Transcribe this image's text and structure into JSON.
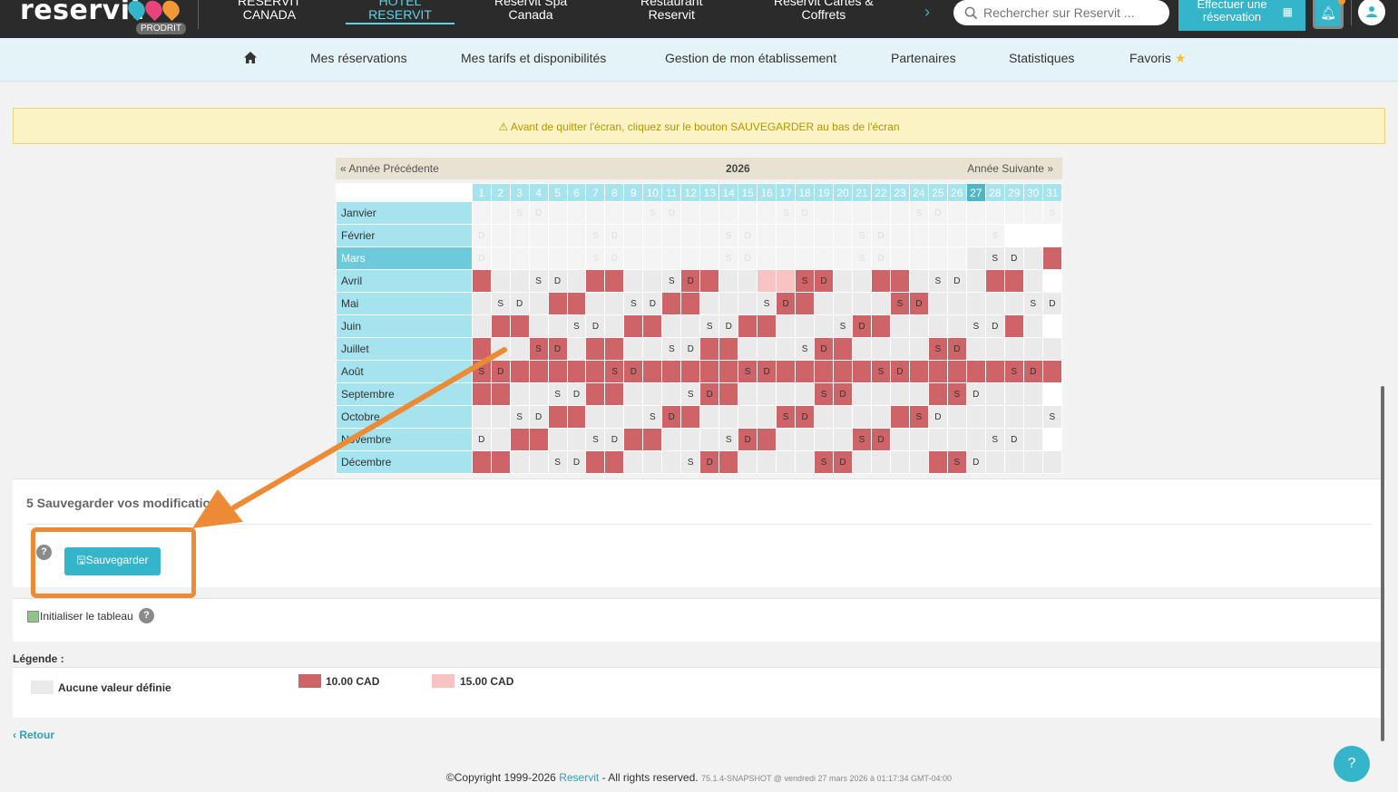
{
  "header": {
    "logo_text": "reservit",
    "logo_badge": "PRODRIT",
    "nav": [
      {
        "line1": "RESERVIT",
        "line2": "CANADA"
      },
      {
        "line1": "HOTEL",
        "line2": "RESERVIT"
      },
      {
        "line1": "Reservit Spa",
        "line2": "Canada"
      },
      {
        "line1": "Restaurant",
        "line2": "Reservit"
      },
      {
        "line1": "Reservit Cartes &",
        "line2": "Coffrets"
      }
    ],
    "search_placeholder": "Rechercher sur Reservit ...",
    "cta_line1": "Effectuer une",
    "cta_line2": "réservation"
  },
  "subnav": {
    "items": [
      "Mes réservations",
      "Mes tarifs et disponibilités",
      "Gestion de mon établissement",
      "Partenaires",
      "Statistiques",
      "Favoris"
    ]
  },
  "warning": "Avant de quitter l'écran, cliquez sur le bouton SAUVEGARDER au bas de l'écran",
  "calendar": {
    "prev": "« Année Précédente",
    "year": "2026",
    "next": "Année Suivante »",
    "today_day": 27,
    "active_month": "Mars",
    "months": [
      {
        "name": "Janvier",
        "cells": "0000000000000000000000000000000",
        "past": 31
      },
      {
        "name": "Février",
        "cells": "0000000000000000000000000000",
        "past": 28
      },
      {
        "name": "Mars",
        "cells": "0000000000000000000000000000001",
        "past": 26
      },
      {
        "name": "Avril",
        "cells": "100000110001100221100110000110",
        "past": 0
      },
      {
        "name": "Mai",
        "cells": "0000110000110000110000110000000",
        "past": 0
      },
      {
        "name": "Juin",
        "cells": "011000001100001100001100000010",
        "past": 0
      },
      {
        "name": "Juillet",
        "cells": "1001101100001100001100001100000",
        "past": 0
      },
      {
        "name": "Août",
        "cells": "1111111111111111111111111111111",
        "past": 0
      },
      {
        "name": "Septembre",
        "cells": "110000110000110000110000110000",
        "past": 0
      },
      {
        "name": "Octobre",
        "cells": "0000110000110000110000110000000",
        "past": 0
      },
      {
        "name": "Novembre",
        "cells": "001100001100001100001100000000",
        "past": 0
      },
      {
        "name": "Décembre",
        "cells": "1100001100001100001100001100000",
        "past": 0
      }
    ],
    "weekends": {
      "Janvier": [
        3,
        4,
        10,
        11,
        17,
        18,
        24,
        25,
        31
      ],
      "Février": [
        1,
        7,
        8,
        14,
        15,
        21,
        22,
        28
      ],
      "Mars": [
        1,
        7,
        8,
        14,
        15,
        21,
        22,
        28,
        29
      ],
      "Avril": [
        4,
        5,
        11,
        12,
        18,
        19,
        25,
        26
      ],
      "Mai": [
        2,
        3,
        9,
        10,
        16,
        17,
        23,
        24,
        30,
        31
      ],
      "Juin": [
        6,
        7,
        13,
        14,
        20,
        21,
        27,
        28
      ],
      "Juillet": [
        4,
        5,
        11,
        12,
        18,
        19,
        25,
        26
      ],
      "Août": [
        1,
        2,
        8,
        9,
        15,
        16,
        22,
        23,
        29,
        30
      ],
      "Septembre": [
        5,
        6,
        12,
        13,
        19,
        20,
        26,
        27
      ],
      "Octobre": [
        3,
        4,
        10,
        11,
        17,
        18,
        24,
        25,
        31
      ],
      "Novembre": [
        1,
        7,
        8,
        14,
        15,
        21,
        22,
        28,
        29
      ],
      "Décembre": [
        5,
        6,
        12,
        13,
        19,
        20,
        26,
        27
      ]
    },
    "sat_label": "S",
    "sun_label": "D"
  },
  "save_section": {
    "title": "5 Sauvegarder vos modifications",
    "button": "Sauvegarder"
  },
  "init_label": "Initialiser le tableau",
  "legend": {
    "title": "Légende :",
    "items": [
      {
        "label": "Aucune valeur définie",
        "color": "#eaeaea"
      },
      {
        "label": "10.00 CAD",
        "color": "#ce6468"
      },
      {
        "label": "15.00 CAD",
        "color": "#f9c3c4"
      }
    ]
  },
  "back_label": "Retour",
  "footer": {
    "copyright": "©Copyright 1999-2026",
    "brand": "Reservit",
    "rights": "- All rights reserved.",
    "version": "75.1.4-SNAPSHOT @ vendredi 27 mars 2026 à 01:17:34 GMT-04:00"
  },
  "colors": {
    "accent": "#35b5c9",
    "annotation": "#ed8a35"
  }
}
